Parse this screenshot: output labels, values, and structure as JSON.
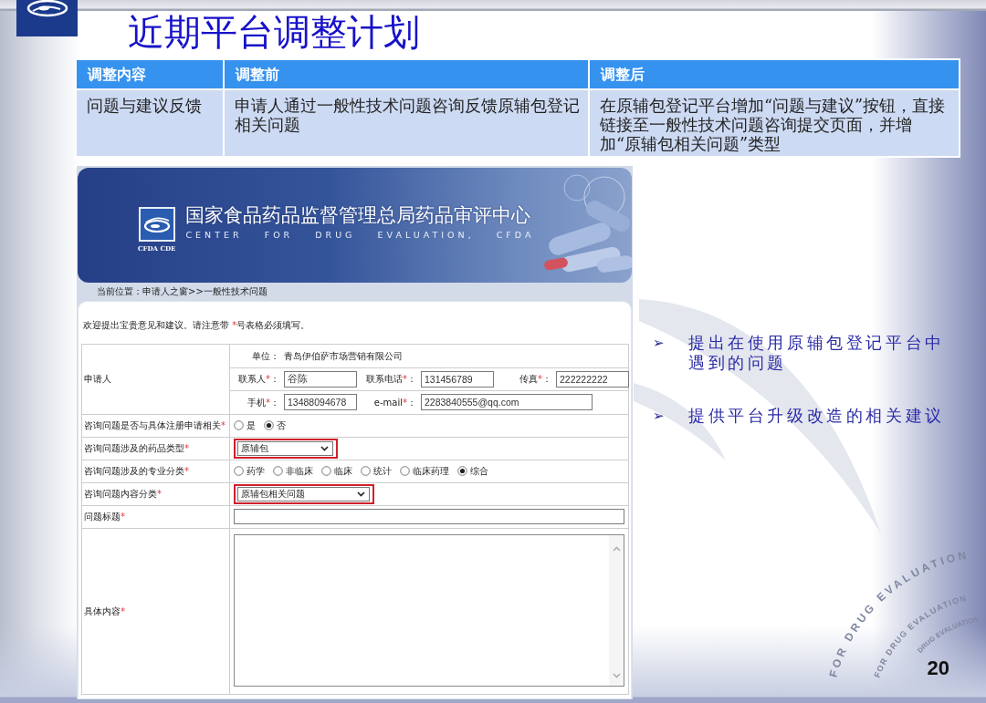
{
  "slide": {
    "title": "近期平台调整计划",
    "page_number": "20"
  },
  "table": {
    "columns": [
      "调整内容",
      "调整前",
      "调整后"
    ],
    "rows": [
      [
        "问题与建议反馈",
        "申请人通过一般性技术问题咨询反馈原辅包登记相关问题",
        "在原辅包登记平台增加“问题与建议”按钮，直接链接至一般性技术问题咨询提交页面，并增加“原辅包相关问题”类型"
      ]
    ]
  },
  "screenshot": {
    "banner": {
      "logo_caption": "CFDA CDE",
      "title": "国家食品药品监督管理总局药品审评中心",
      "subtitle": "CENTER FOR DRUG EVALUATION, CFDA"
    },
    "breadcrumb": "当前位置：申请人之窗>>一般性技术问题",
    "intro": {
      "before": "欢迎提出宝贵意见和建议。请注意带 ",
      "mark": "*",
      "after": "号表格必须填写。"
    },
    "applicant": {
      "label": "申请人",
      "lines": [
        [
          {
            "kind": "text",
            "label": "单位：",
            "value": "青岛伊伯萨市场营销有限公司"
          }
        ],
        [
          {
            "kind": "input",
            "label": "联系人",
            "mark": "*",
            "colon": "：",
            "value": "谷陈"
          },
          {
            "kind": "input",
            "label": "联系电话",
            "mark": "*",
            "colon": "：",
            "value": "131456789"
          },
          {
            "kind": "input",
            "label": "传真",
            "mark": "*",
            "colon": "：",
            "value": "222222222"
          }
        ],
        [
          {
            "kind": "input",
            "label": "手机",
            "mark": "*",
            "colon": "：",
            "value": "13488094678"
          },
          {
            "kind": "input",
            "label": "e-mail",
            "mark": "*",
            "colon": "：",
            "value": "2283840555@qq.com"
          }
        ]
      ]
    },
    "rows": [
      {
        "kind": "radio",
        "label": "咨询问题是否与具体注册申请相关",
        "mark": "*",
        "options": [
          {
            "label": "是",
            "selected": false
          },
          {
            "label": "否",
            "selected": true
          }
        ]
      },
      {
        "kind": "select",
        "label": "咨询问题涉及的药品类型",
        "mark": "*",
        "value": "原辅包",
        "highlighted": true
      },
      {
        "kind": "radio",
        "label": "咨询问题涉及的专业分类",
        "mark": "*",
        "options": [
          {
            "label": "药学",
            "selected": false
          },
          {
            "label": "非临床",
            "selected": false
          },
          {
            "label": "临床",
            "selected": false
          },
          {
            "label": "统计",
            "selected": false
          },
          {
            "label": "临床药理",
            "selected": false
          },
          {
            "label": "综合",
            "selected": true
          }
        ]
      },
      {
        "kind": "select",
        "label": "咨询问题内容分类",
        "mark": "*",
        "value": "原辅包相关问题",
        "highlighted": true
      },
      {
        "kind": "input",
        "label": "问题标题",
        "mark": "*"
      },
      {
        "kind": "textarea",
        "label": "具体内容",
        "mark": "*"
      }
    ]
  },
  "bullets": [
    {
      "marker": "➢",
      "text": "提出在使用原辅包登记平台中遇到的问题"
    },
    {
      "marker": "➢",
      "text": "提供平台升级改造的相关建议"
    }
  ],
  "emblem": {
    "rings": [
      "FOR DRUG EVALUATION",
      "FOR DRUG EVALUATION",
      "DRUG EVALUATION"
    ]
  }
}
